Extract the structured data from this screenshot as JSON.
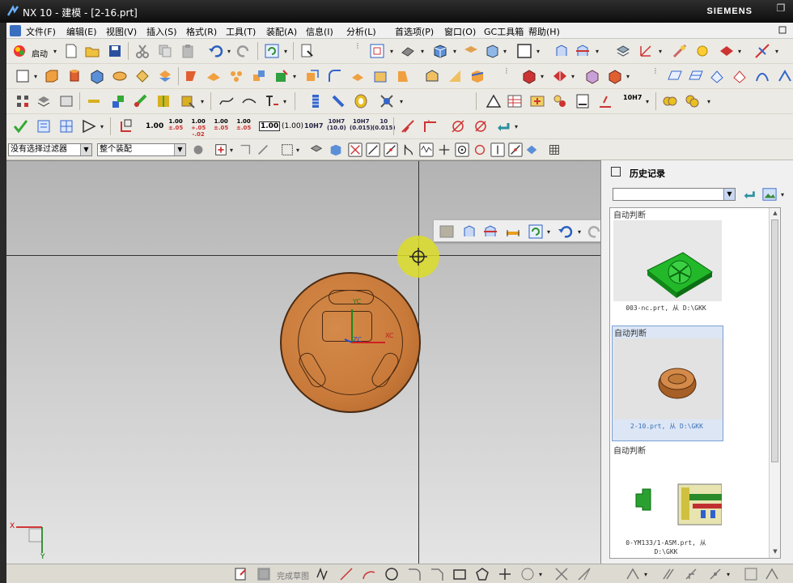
{
  "window": {
    "title": "NX 10 - 建模 - [2-16.prt]",
    "brand": "SIEMENS",
    "maximize_glyph": "❐"
  },
  "menubar": {
    "items": [
      "文件(F)",
      "编辑(E)",
      "视图(V)",
      "插入(S)",
      "格式(R)",
      "工具(T)",
      "装配(A)",
      "信息(I)",
      "分析(L)",
      "首选项(P)",
      "窗口(O)",
      "GC工具箱",
      "帮助(H)"
    ]
  },
  "toolbar": {
    "start_label": "启动",
    "tolerance_labels": [
      "1.00",
      "1.00",
      "1.00",
      "1.00",
      "1.00",
      "1.00",
      "(1.00)",
      "10H7"
    ],
    "tolerance_small": [
      "±.05",
      "+.05\n-.02",
      "±.05",
      "±.05"
    ],
    "fit_labels": [
      "10H7\n(10.0)",
      "10H7\n(0.015)",
      "10\n(0.015)"
    ],
    "fit2": "10H7"
  },
  "selection_bar": {
    "filter_value": "没有选择过滤器",
    "scope_value": "整个装配"
  },
  "viewport": {
    "axis_labels": {
      "xc": "XC",
      "yc": "YC",
      "zc": "ZC",
      "x": "X",
      "y": "Y"
    }
  },
  "history_panel": {
    "title": "历史记录",
    "items": [
      {
        "label": "自动判断",
        "file": "003-nc.prt, 从 D:\\GKK"
      },
      {
        "label": "自动判断",
        "file": "2-10.prt, 从 D:\\GKK"
      },
      {
        "label": "自动判断",
        "file": "0-YM133/1-ASM.prt, 从\nD:\\GKK"
      }
    ]
  },
  "bottom_toolbar": {
    "label": "完成草图"
  },
  "colors": {
    "part_body": "#c97a3a",
    "cursor_highlight": "#dcdc28",
    "selected_item": "#dce6f5"
  }
}
